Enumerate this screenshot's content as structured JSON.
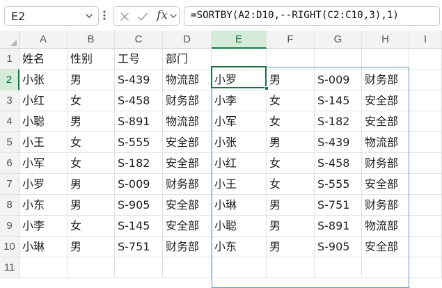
{
  "name_box": "E2",
  "formula": "=SORTBY(A2:D10,--RIGHT(C2:C10,3),1)",
  "columns": [
    "A",
    "B",
    "C",
    "D",
    "E",
    "F",
    "G",
    "H",
    "I"
  ],
  "rows": [
    "1",
    "2",
    "3",
    "4",
    "5",
    "6",
    "7",
    "8",
    "9",
    "10",
    "11"
  ],
  "source_header": [
    "姓名",
    "性别",
    "工号",
    "部门"
  ],
  "source_rows": [
    [
      "小张",
      "男",
      "S-439",
      "物流部"
    ],
    [
      "小红",
      "女",
      "S-458",
      "财务部"
    ],
    [
      "小聪",
      "男",
      "S-891",
      "物流部"
    ],
    [
      "小王",
      "女",
      "S-555",
      "安全部"
    ],
    [
      "小军",
      "女",
      "S-182",
      "安全部"
    ],
    [
      "小罗",
      "男",
      "S-009",
      "财务部"
    ],
    [
      "小东",
      "男",
      "S-905",
      "安全部"
    ],
    [
      "小李",
      "女",
      "S-145",
      "安全部"
    ],
    [
      "小琳",
      "男",
      "S-751",
      "财务部"
    ]
  ],
  "result_rows": [
    [
      "小罗",
      "男",
      "S-009",
      "财务部"
    ],
    [
      "小李",
      "女",
      "S-145",
      "安全部"
    ],
    [
      "小军",
      "女",
      "S-182",
      "安全部"
    ],
    [
      "小张",
      "男",
      "S-439",
      "物流部"
    ],
    [
      "小红",
      "女",
      "S-458",
      "财务部"
    ],
    [
      "小王",
      "女",
      "S-555",
      "安全部"
    ],
    [
      "小琳",
      "男",
      "S-751",
      "财务部"
    ],
    [
      "小聪",
      "男",
      "S-891",
      "物流部"
    ],
    [
      "小东",
      "男",
      "S-905",
      "安全部"
    ]
  ],
  "colors": {
    "accent_green": "#107c41",
    "spill_border": "#5b8fd4",
    "header_bg": "#f3f3f3",
    "selected_header_bg": "#d3ebd9"
  },
  "icons": {
    "name_box_dropdown": "chevron-down-icon",
    "cancel": "x-icon",
    "confirm": "check-icon",
    "function": "fx-icon",
    "more": "vertical-dots-icon"
  }
}
